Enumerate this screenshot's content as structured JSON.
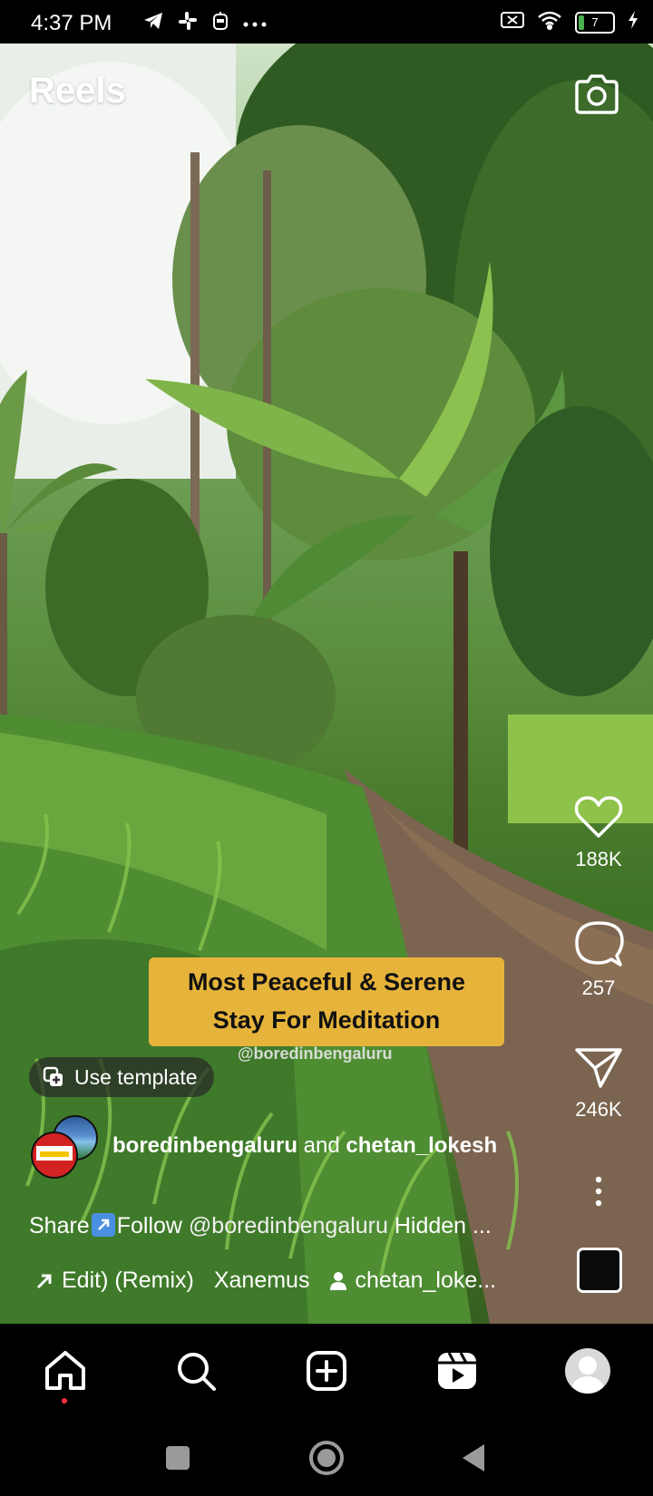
{
  "status_bar": {
    "time": "4:37 PM",
    "left_icons": [
      "telegram-icon",
      "slack-icon",
      "app-icon",
      "more-dots-icon"
    ],
    "right_icons": [
      "no-sim-icon",
      "wifi-icon",
      "battery-icon",
      "charging-icon"
    ],
    "battery_level": "7"
  },
  "header": {
    "title": "Reels",
    "camera_icon": "camera-icon"
  },
  "video": {
    "caption_line1": "Most Peaceful & Serene",
    "caption_line2": "Stay For Meditation",
    "watermark": "@boredinbengaluru",
    "caption_bg": "#e6b43b"
  },
  "use_template": {
    "label": "Use template"
  },
  "author": {
    "name": "boredinbengaluru",
    "joiner": "and",
    "collaborator": "chetan_lokesh"
  },
  "description": {
    "share_text": "Share",
    "follow_text": "Follow",
    "mention": "@boredinbengaluru",
    "rest": "Hidden ..."
  },
  "audio": {
    "track": "Edit) (Remix)",
    "artist": "Xanemus",
    "tagged_user": "chetan_loke..."
  },
  "actions": {
    "likes": "188K",
    "comments": "257",
    "shares": "246K"
  },
  "bottom_nav": {
    "items": [
      "home-icon",
      "search-icon",
      "create-icon",
      "reels-icon",
      "profile-icon"
    ],
    "active": "home",
    "notification_dot_color": "#ff3040"
  },
  "android_nav": [
    "recents-button",
    "home-button",
    "back-button"
  ]
}
